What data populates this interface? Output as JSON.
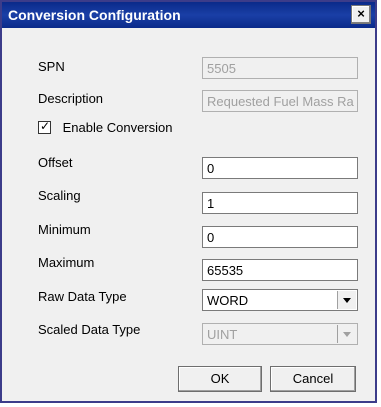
{
  "window": {
    "title": "Conversion Configuration",
    "close_label": "×"
  },
  "form": {
    "spn": {
      "label": "SPN",
      "value": "5505"
    },
    "description": {
      "label": "Description",
      "value": "Requested Fuel Mass Ra"
    },
    "enable_conversion": {
      "label": "Enable Conversion",
      "checked": true
    },
    "offset": {
      "label": "Offset",
      "value": "0"
    },
    "scaling": {
      "label": "Scaling",
      "value": "1"
    },
    "minimum": {
      "label": "Minimum",
      "value": "0"
    },
    "maximum": {
      "label": "Maximum",
      "value": "65535"
    },
    "raw_data_type": {
      "label": "Raw Data Type",
      "value": "WORD"
    },
    "scaled_data_type": {
      "label": "Scaled Data Type",
      "value": "UINT"
    }
  },
  "buttons": {
    "ok": "OK",
    "cancel": "Cancel"
  }
}
